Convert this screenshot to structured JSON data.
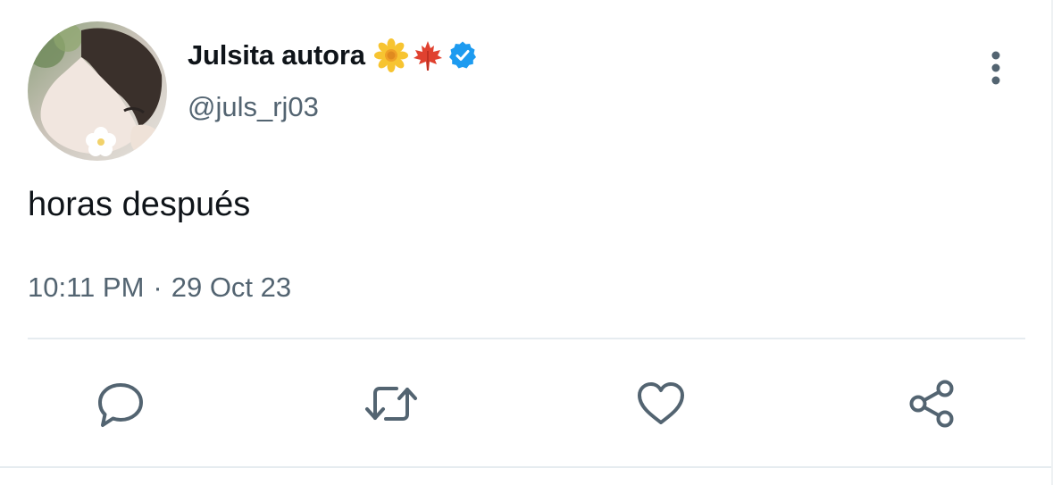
{
  "author": {
    "display_name": "Julsita autora",
    "handle": "@juls_rj03",
    "badges": [
      "sunflower-emoji",
      "maple-leaf-emoji",
      "verified-badge-icon"
    ],
    "verified_color": "#1d9bf0"
  },
  "tweet": {
    "text": "horas después",
    "time": "10:11 PM",
    "separator": "·",
    "date": "29 Oct 23"
  },
  "actions": {
    "reply": "reply-icon",
    "retweet": "retweet-icon",
    "like": "heart-icon",
    "share": "share-icon"
  },
  "menu": {
    "icon": "more-vertical-icon"
  },
  "colors": {
    "text_primary": "#0f1419",
    "text_secondary": "#536471",
    "icon": "#536471",
    "divider": "#e6ecf0"
  }
}
